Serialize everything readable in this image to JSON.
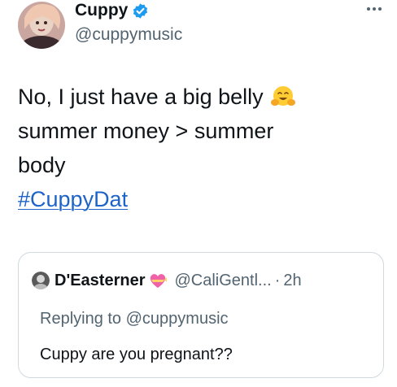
{
  "author": {
    "display_name": "Cuppy",
    "handle": "@cuppymusic"
  },
  "tweet": {
    "line1": "No, I just have a big belly",
    "line2": "summer money > summer",
    "line3": "body",
    "hashtag": "#CuppyDat"
  },
  "quote": {
    "display_name": "D'Easterner",
    "handle": "@CaliGentl...",
    "separator": "·",
    "time": "2h",
    "replying_to": "Replying to @cuppymusic",
    "text": "Cuppy are you pregnant??"
  },
  "colors": {
    "link": "#1d63c8",
    "verified": "#1d9bf0",
    "secondary_text": "#536471",
    "border": "#cfd9de"
  },
  "icons": {
    "verified": "verified-badge-icon",
    "more": "more-options-icon",
    "hug": "hugging-face-emoji",
    "heart": "heart-with-ribbon-emoji"
  }
}
